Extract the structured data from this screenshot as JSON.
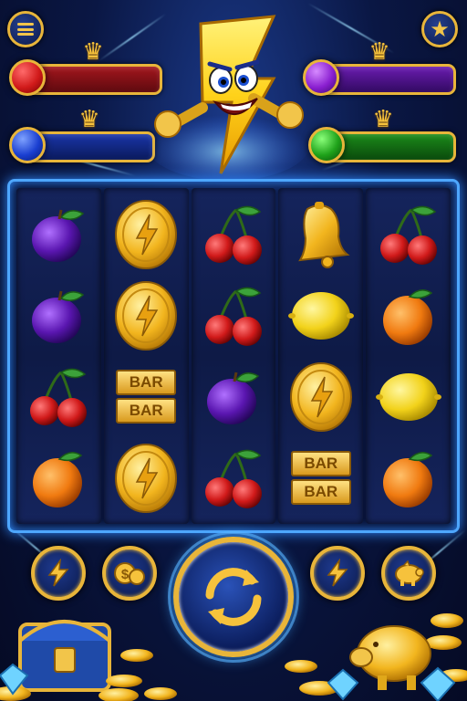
{
  "header": {
    "menu_icon": "menu-icon",
    "star_icon": "star-icon"
  },
  "players": [
    {
      "color": "red",
      "orb": "#d11a1a",
      "fill": "#7a0f14",
      "crown": true
    },
    {
      "color": "purple",
      "orb": "#8a1fd0",
      "fill": "#4a137f",
      "crown": true
    },
    {
      "color": "blue",
      "orb": "#1a3fd1",
      "fill": "#0d2375",
      "crown": true
    },
    {
      "color": "green",
      "orb": "#1fa21a",
      "fill": "#0d5010",
      "crown": true
    }
  ],
  "reels": [
    [
      "plum",
      "plum",
      "cherry",
      "orange"
    ],
    [
      "coin",
      "coin",
      "bar",
      "coin"
    ],
    [
      "cherry",
      "cherry",
      "plum",
      "cherry"
    ],
    [
      "bell",
      "lemon",
      "coin",
      "bar"
    ],
    [
      "cherry",
      "orange",
      "lemon",
      "orange"
    ]
  ],
  "bar_label": "BAR",
  "controls": {
    "left_1": "lightning-icon",
    "left_2": "coin-stack-icon",
    "spin": "spin-arrows-icon",
    "right_1": "lightning-icon",
    "right_2": "piggy-bank-icon"
  },
  "colors": {
    "gold": "#e8b53a",
    "frame_glow": "#4ea7ff",
    "background": "#0a1744"
  }
}
